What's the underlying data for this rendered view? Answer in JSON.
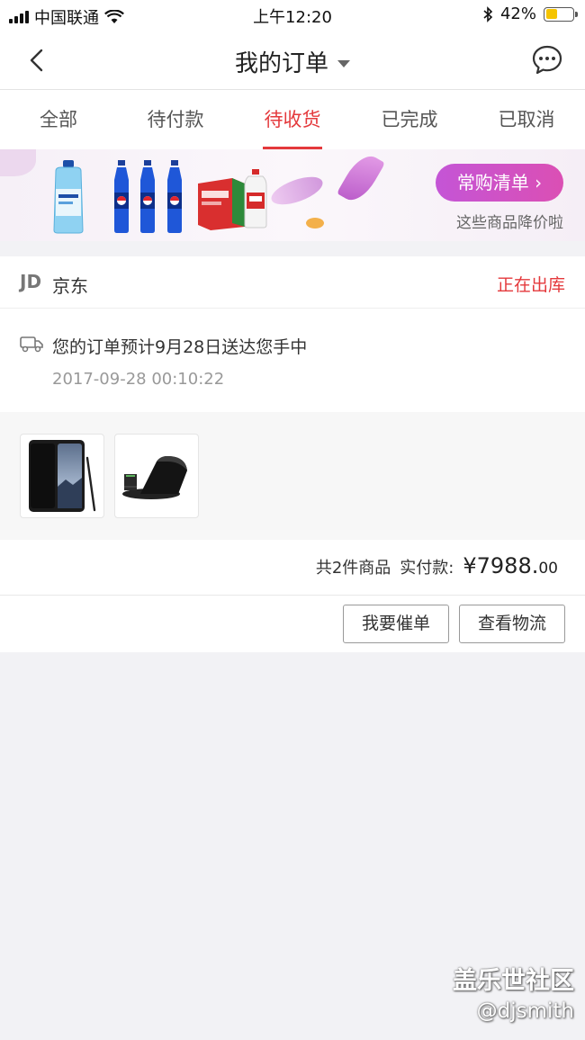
{
  "status_bar": {
    "carrier": "中国联通",
    "time": "上午12:20",
    "battery_percent": "42%",
    "battery_level": 0.42
  },
  "nav": {
    "title": "我的订单",
    "back_icon": "chevron-left-icon",
    "message_icon": "chat-bubble-icon"
  },
  "tabs": [
    {
      "label": "全部",
      "active": false
    },
    {
      "label": "待付款",
      "active": false
    },
    {
      "label": "待收货",
      "active": true
    },
    {
      "label": "已完成",
      "active": false
    },
    {
      "label": "已取消",
      "active": false
    }
  ],
  "banner": {
    "button_label": "常购清单",
    "subtitle": "这些商品降价啦",
    "accent_color": "#c455d6"
  },
  "order": {
    "store_logo": "JD",
    "store_name": "京东",
    "status": "正在出库",
    "status_color": "#e4393c",
    "delivery_message": "您的订单预计9月28日送达您手中",
    "delivery_time": "2017-09-28 00:10:22",
    "items": [
      {
        "icon": "phone-product-image"
      },
      {
        "icon": "wireless-charger-product-image"
      }
    ],
    "item_count_label": "共2件商品",
    "paid_label": "实付款:",
    "amount_main": "¥7988.",
    "amount_cents": "00"
  },
  "actions": {
    "urge_label": "我要催单",
    "logistics_label": "查看物流"
  },
  "watermark": {
    "title": "盖乐世社区",
    "handle": "@djsmith"
  }
}
